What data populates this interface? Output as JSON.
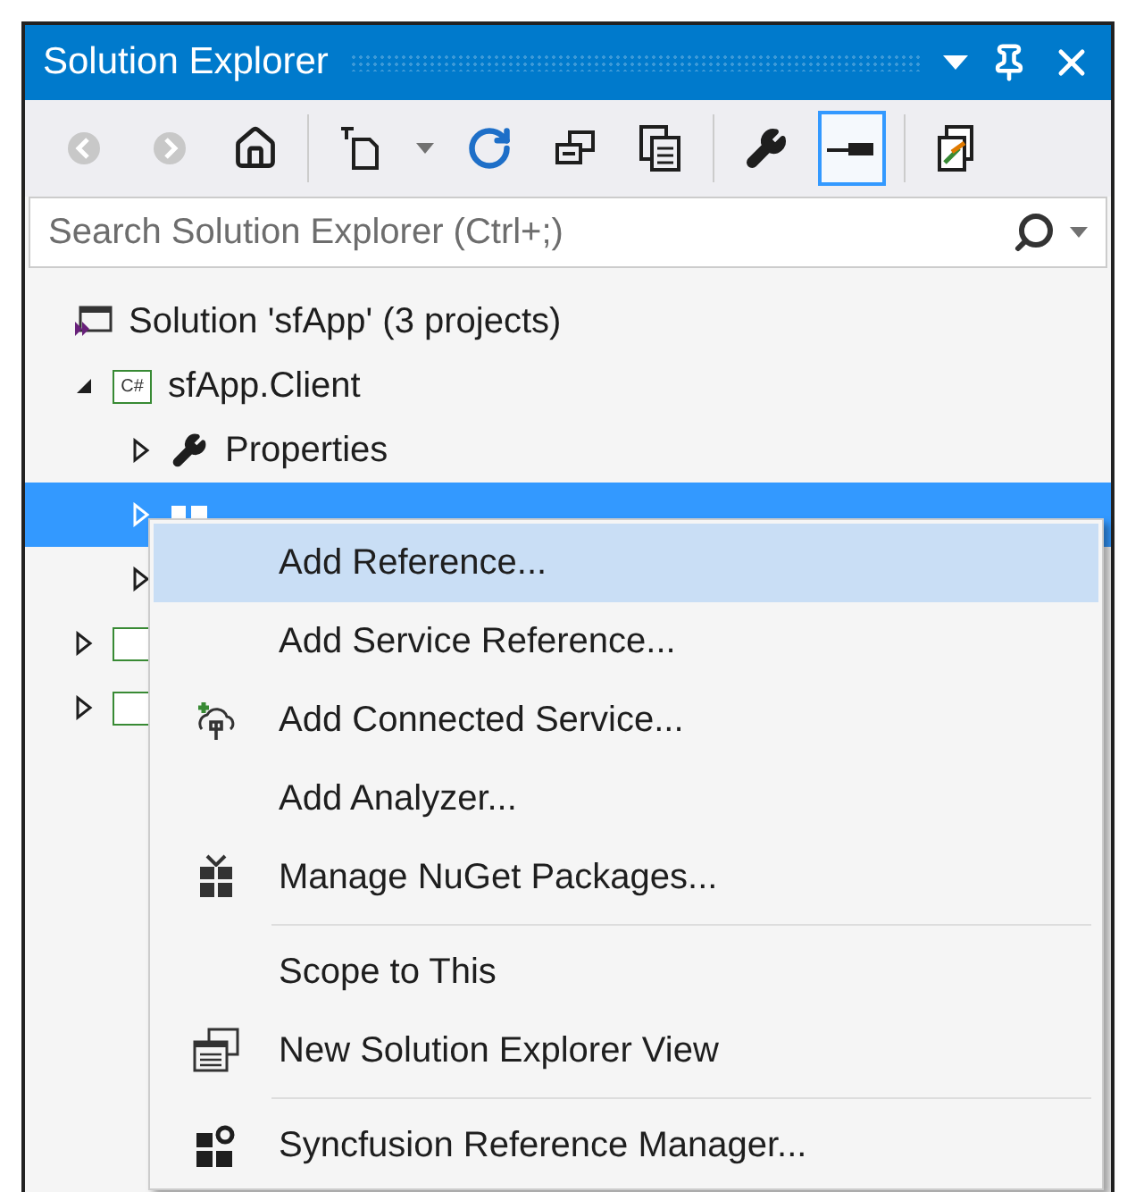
{
  "window": {
    "title": "Solution Explorer"
  },
  "toolbar": [
    {
      "disabled": true,
      "selected": false
    },
    {
      "disabled": true,
      "selected": false
    },
    {
      "disabled": false,
      "selected": false
    },
    {
      "disabled": false,
      "selected": false
    },
    {
      "disabled": false,
      "selected": false
    },
    {
      "disabled": false,
      "selected": false
    },
    {
      "disabled": false,
      "selected": false
    },
    {
      "disabled": false,
      "selected": false
    },
    {
      "disabled": false,
      "selected": false
    },
    {
      "disabled": false,
      "selected": true
    },
    {
      "disabled": false,
      "selected": false
    }
  ],
  "search": {
    "placeholder": "Search Solution Explorer (Ctrl+;)"
  },
  "tree": [
    {
      "label": "Solution 'sfApp' (3 projects)",
      "kind": "solution",
      "selected": false,
      "children": [
        {
          "label": "sfApp.Client",
          "badge": "C#",
          "kind": "project",
          "expanded": true,
          "selected": false,
          "children": [
            {
              "label": "Properties",
              "kind": "properties",
              "expanded": false,
              "selected": false
            },
            {
              "kind": "references",
              "expanded": false,
              "selected": true
            },
            {
              "kind": "folder",
              "expanded": false,
              "selected": false
            }
          ]
        },
        {
          "kind": "project",
          "expanded": false,
          "selected": false
        },
        {
          "kind": "project",
          "expanded": false,
          "selected": false
        }
      ]
    }
  ],
  "context_menu": [
    {
      "kind": "command",
      "label": "Add Reference...",
      "selected": true
    },
    {
      "kind": "command",
      "label": "Add Service Reference...",
      "selected": false
    },
    {
      "kind": "command",
      "label": "Add Connected Service...",
      "selected": false
    },
    {
      "kind": "command",
      "label": "Add Analyzer...",
      "selected": false
    },
    {
      "kind": "command",
      "label": "Manage NuGet Packages...",
      "selected": false
    },
    {
      "kind": "separator"
    },
    {
      "kind": "command",
      "label": "Scope to This",
      "selected": false
    },
    {
      "kind": "command",
      "label": "New Solution Explorer View",
      "selected": false
    },
    {
      "kind": "separator"
    },
    {
      "kind": "command",
      "label": "Syncfusion Reference Manager...",
      "selected": false
    }
  ]
}
